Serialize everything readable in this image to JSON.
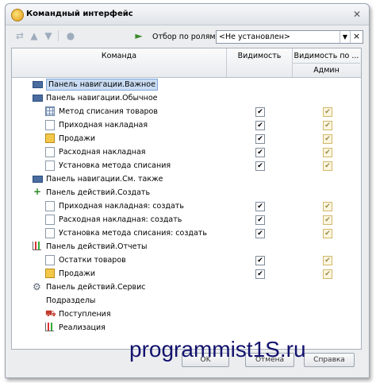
{
  "window": {
    "title": "Командный интерфейс",
    "close": "✕"
  },
  "toolbar": {
    "role_filter_label": "Отбор по ролям:",
    "role_filter_value": "<Не установлен>",
    "dropdown": "▼",
    "clear": "×"
  },
  "table": {
    "columns": {
      "command": "Команда",
      "visibility": "Видимость",
      "visibility_by_role": "Видимость по ...",
      "admin": "Админ"
    },
    "rows": [
      {
        "label": "Панель навигации.Важное",
        "icon": "nav-panel-icon",
        "selected": true
      },
      {
        "label": "Панель навигации.Обычное",
        "icon": "nav-panel-icon"
      },
      {
        "label": "Метод списания товаров",
        "icon": "grid-icon",
        "visibility": true,
        "admin": true
      },
      {
        "label": "Приходная накладная",
        "icon": "document-icon",
        "visibility": true,
        "admin": true
      },
      {
        "label": "Продажи",
        "icon": "sales-icon",
        "visibility": true,
        "admin": true
      },
      {
        "label": "Расходная накладная",
        "icon": "document-icon",
        "visibility": true,
        "admin": true
      },
      {
        "label": "Установка метода списания",
        "icon": "document-icon",
        "visibility": true,
        "admin": true
      },
      {
        "label": "Панель навигации.См. также",
        "icon": "nav-panel-icon"
      },
      {
        "label": "Панель действий.Создать",
        "icon": "create-icon"
      },
      {
        "label": "Приходная накладная: создать",
        "icon": "document-icon",
        "visibility": true,
        "admin": true
      },
      {
        "label": "Расходная накладная: создать",
        "icon": "document-icon",
        "visibility": true,
        "admin": true
      },
      {
        "label": "Установка метода списания: создать",
        "icon": "document-icon",
        "visibility": true,
        "admin": true
      },
      {
        "label": "Панель действий.Отчеты",
        "icon": "reports-icon"
      },
      {
        "label": "Остатки товаров",
        "icon": "document-icon",
        "visibility": true,
        "admin": true
      },
      {
        "label": "Продажи",
        "icon": "sales-icon",
        "visibility": true,
        "admin": true
      },
      {
        "label": "Панель действий.Сервис",
        "icon": "gear-icon"
      },
      {
        "label": "Подразделы",
        "icon": "none"
      },
      {
        "label": "Поступления",
        "icon": "receipts-icon"
      },
      {
        "label": "Реализация",
        "icon": "chart-icon"
      }
    ]
  },
  "footer": {
    "ok": "OK",
    "cancel": "Отмена",
    "help": "Справка"
  },
  "watermark": "programmist1S.ru",
  "check_glyph": "✔"
}
